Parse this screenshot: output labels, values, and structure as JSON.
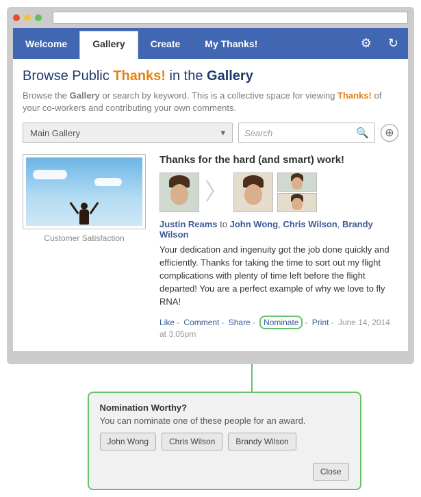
{
  "nav": {
    "tabs": [
      "Welcome",
      "Gallery",
      "Create",
      "My Thanks!"
    ],
    "active_index": 1
  },
  "page": {
    "title_prefix": "Browse Public ",
    "title_highlight": "Thanks!",
    "title_suffix": " in the ",
    "title_bold": "Gallery",
    "subtext_1a": "Browse the ",
    "subtext_1b": "Gallery",
    "subtext_1c": " or search by keyword. This is a collective space for viewing ",
    "subtext_1d": "Thanks!",
    "subtext_1e": " of your co-workers and contributing your own comments."
  },
  "filters": {
    "select_value": "Main Gallery",
    "search_placeholder": "Search"
  },
  "post": {
    "thumbnail_label": "Customer Satisfaction",
    "title": "Thanks for the hard (and smart) work!",
    "from": "Justin Reams",
    "to_word": "to",
    "recipients": [
      "John Wong",
      "Chris Wilson",
      "Brandy Wilson"
    ],
    "body": "Your dedication and ingenuity got the job done quickly and efficiently. Thanks for taking the time to sort out my flight complications with plenty of time left before the flight departed!  You are a perfect example of why we love to fly RNA!",
    "actions": {
      "like": "Like",
      "comment": "Comment",
      "share": "Share",
      "nominate": "Nominate",
      "print": "Print"
    },
    "timestamp": "June 14, 2014 at 3:05pm"
  },
  "popover": {
    "title": "Nomination Worthy?",
    "desc": "You can nominate one of these people for an award.",
    "options": [
      "John Wong",
      "Chris Wilson",
      "Brandy Wilson"
    ],
    "close": "Close"
  }
}
